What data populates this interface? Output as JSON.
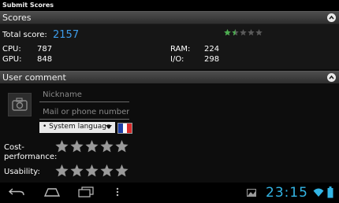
{
  "titlebar": {
    "title": "Submit Scores"
  },
  "scores": {
    "header": "Scores",
    "total_label": "Total score:",
    "total_value": "2157",
    "rating_stars": 1.5,
    "rating_max": 5,
    "cpu_label": "CPU:",
    "cpu_value": "787",
    "gpu_label": "GPU:",
    "gpu_value": "848",
    "ram_label": "RAM:",
    "ram_value": "224",
    "io_label": "I/O:",
    "io_value": "298"
  },
  "comment": {
    "header": "User comment",
    "nickname_placeholder": "Nickname",
    "contact_placeholder": "Mail or phone number",
    "language_label": "• System language",
    "cost_performance_label": "Cost-\nperformance:",
    "cost_performance_stars": 0,
    "usability_label": "Usability:",
    "usability_stars": 0
  },
  "status_bar": {
    "time": "23:15"
  },
  "colors": {
    "accent": "#3d9be9",
    "clock": "#33b5e5",
    "star_filled": "#4caf50",
    "star_empty": "#9a9a9a"
  }
}
